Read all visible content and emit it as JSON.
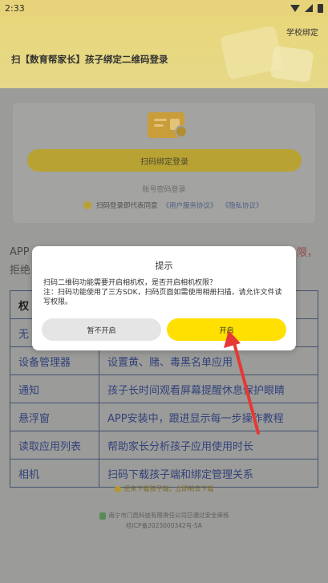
{
  "status_bar": {
    "time": "2:33"
  },
  "header": {
    "school_bind": "学校绑定",
    "scan_title": "扫【数育帮家长】孩子绑定二维码登录"
  },
  "login": {
    "scan_button": "扫码绑定登录",
    "password_login": "账号密码登录",
    "agree_prefix": "扫码登录即代表同意",
    "agreement_link": "《用户服务协议》",
    "privacy_link": "《隐私协议》"
  },
  "notice": {
    "line1_left": "APP",
    "line1_right": "限，",
    "line2": "拒绝"
  },
  "permissions": {
    "header_col1": "权",
    "header_col2": "",
    "rows": [
      {
        "name": "无",
        "desc": ""
      },
      {
        "name": "设备管理器",
        "desc": "设置黄、赌、毒黑名单应用"
      },
      {
        "name": "通知",
        "desc": "孩子长时间观看屏幕提醒休息保护眼睛"
      },
      {
        "name": "悬浮窗",
        "desc": "APP安装中，跟进显示每一步操作教程"
      },
      {
        "name": "读取应用列表",
        "desc": "帮助家长分析孩子应用使用时长"
      },
      {
        "name": "相机",
        "desc": "扫码下载孩子端和绑定管理关系"
      }
    ]
  },
  "bottom": {
    "tip": "还未下载孩子端，立即前去下载",
    "company": "南宁市门邑科技有限责任公司已通过安全审核",
    "icp": "桂ICP备2023000342号-5A"
  },
  "dialog": {
    "title": "提示",
    "message_line1": "扫码二维码功能需要开启相机权，是否开启相机权限？",
    "message_line2": "注：扫码功能使用了三方SDK，扫码页面如需使用相册扫描，请允许文件读写权限。",
    "cancel": "暂不开启",
    "confirm": "开启"
  },
  "colors": {
    "accent": "#ffe000",
    "arrow": "#e53935",
    "link": "#4c5f84"
  },
  "icons": [
    "wifi-icon",
    "signal-icon",
    "battery-icon",
    "id-card-icon",
    "warning-icon",
    "shield-icon"
  ]
}
